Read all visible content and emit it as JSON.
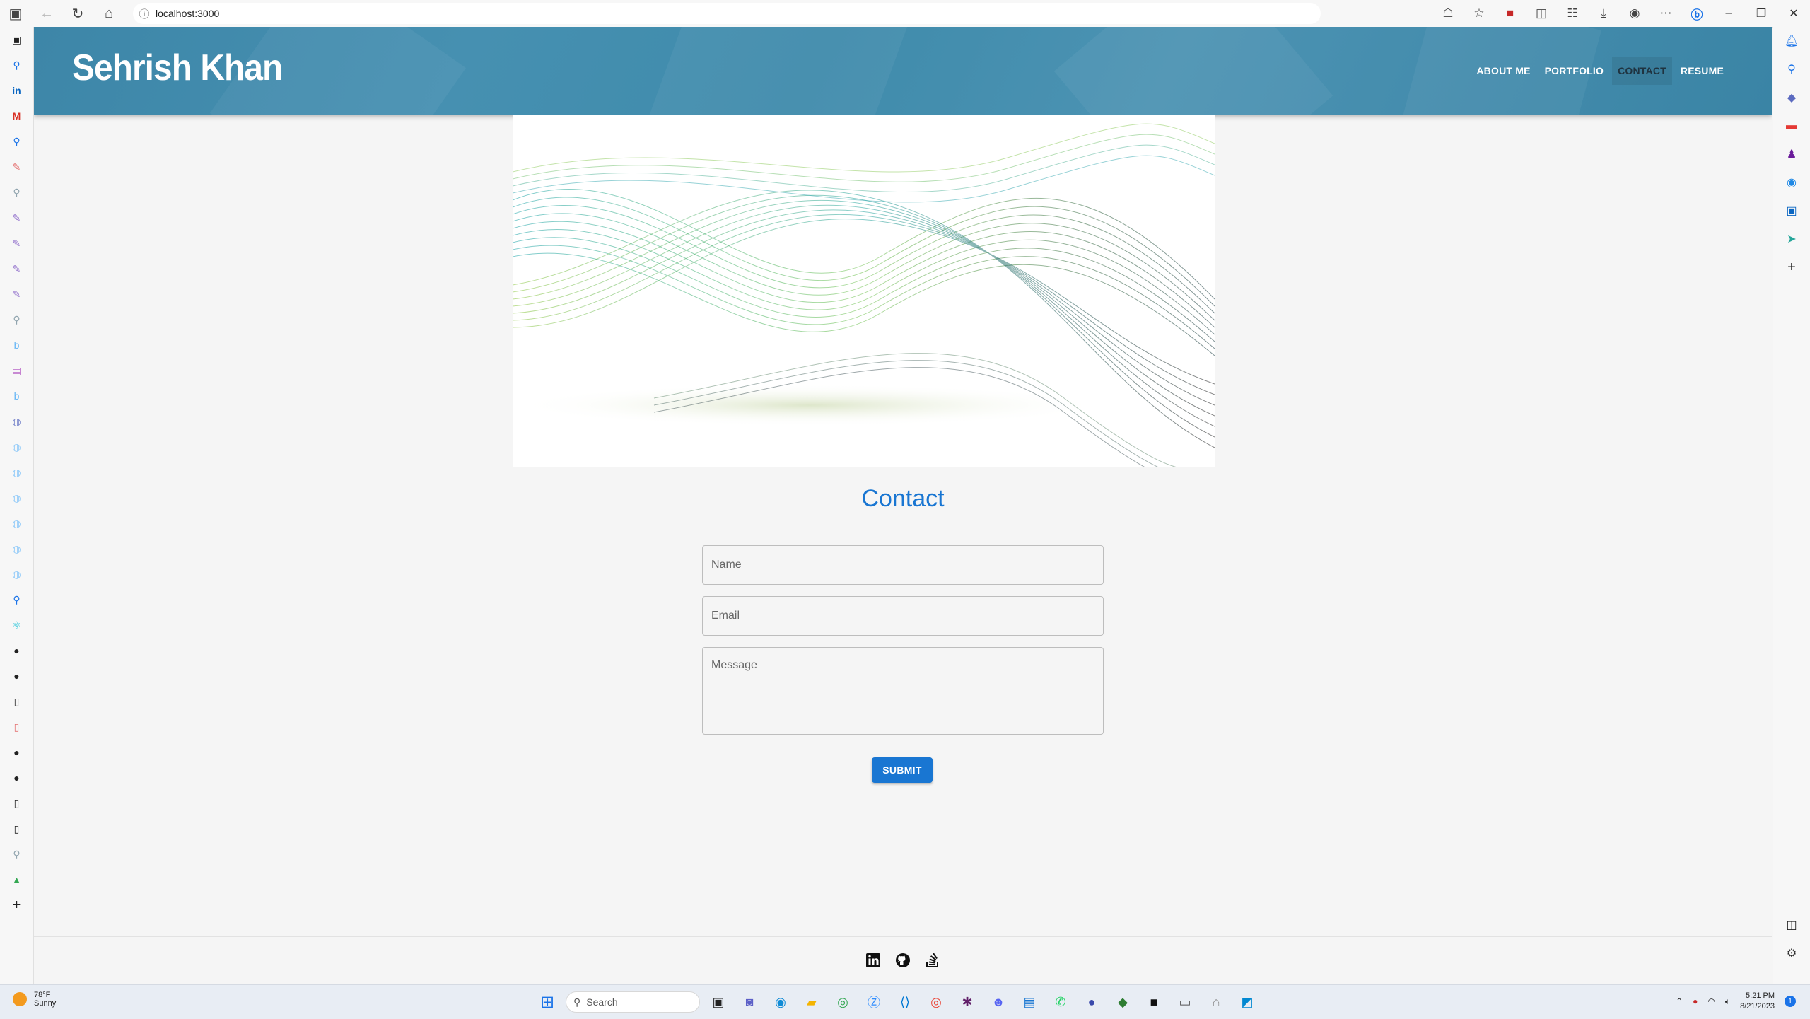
{
  "browser": {
    "url": "localhost:3000"
  },
  "site": {
    "brand": "Sehrish Khan",
    "nav": [
      {
        "label": "ABOUT ME",
        "active": false
      },
      {
        "label": "PORTFOLIO",
        "active": false
      },
      {
        "label": "CONTACT",
        "active": true
      },
      {
        "label": "RESUME",
        "active": false
      }
    ],
    "header_color": "#4690b1"
  },
  "contact": {
    "title": "Contact",
    "name_placeholder": "Name",
    "email_placeholder": "Email",
    "message_placeholder": "Message",
    "submit_label": "SUBMIT",
    "accent": "#1976d2"
  },
  "footer": {
    "icons": [
      "linkedin-icon",
      "github-icon",
      "stackoverflow-icon"
    ]
  },
  "taskbar": {
    "weather_temp": "78°F",
    "weather_desc": "Sunny",
    "search_label": "Search",
    "time": "5:21 PM",
    "date": "8/21/2023",
    "notification_count": "1"
  }
}
